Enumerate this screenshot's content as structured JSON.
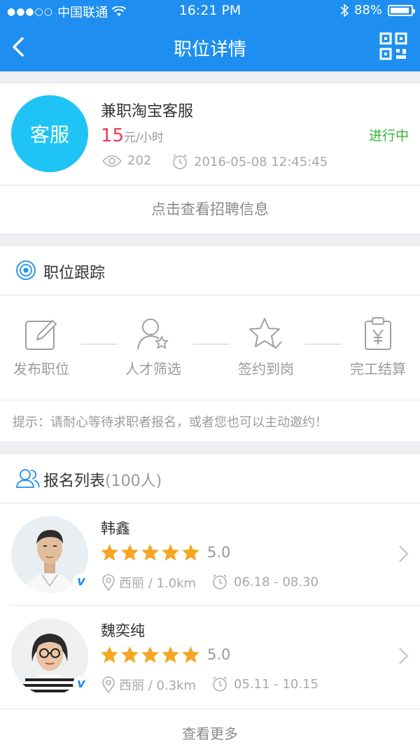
{
  "status_bar": {
    "carrier": "中国联通",
    "time": "16:21 PM",
    "battery": "88%"
  },
  "nav": {
    "title": "职位详情"
  },
  "job": {
    "avatar_text": "客服",
    "title": "兼职淘宝客服",
    "price": "15",
    "price_unit": "元/小时",
    "status": "进行中",
    "views": "202",
    "datetime": "2016-05-08 12:45:45",
    "link_text": "点击查看招聘信息"
  },
  "tracking": {
    "title": "职位跟踪",
    "steps": [
      {
        "label": "发布职位",
        "icon": "edit-icon"
      },
      {
        "label": "人才筛选",
        "icon": "user-star-icon"
      },
      {
        "label": "签约到岗",
        "icon": "star-check-icon"
      },
      {
        "label": "完工结算",
        "icon": "clipboard-yen-icon"
      }
    ],
    "tip": "提示：请耐心等待求职者报名，或者您也可以主动邀约！"
  },
  "signup": {
    "title": "报名列表",
    "count": "(100人)",
    "items": [
      {
        "name": "韩鑫",
        "rating": 5,
        "score": "5.0",
        "location": "西丽 / 1.0km",
        "period": "06.18 - 08.30"
      },
      {
        "name": "魏奕纯",
        "rating": 5,
        "score": "5.0",
        "location": "西丽 / 0.3km",
        "period": "05.11 - 10.15"
      }
    ],
    "more_text": "查看更多"
  },
  "colors": {
    "brand": "#1e8ff0",
    "avatar": "#1fc4f4",
    "price": "#ea3b55",
    "status": "#2eb82e",
    "star": "#f5a623"
  }
}
